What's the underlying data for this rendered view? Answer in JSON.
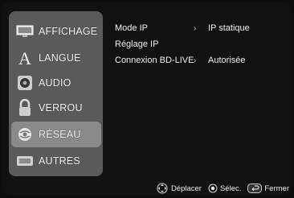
{
  "menu": {
    "items": [
      {
        "label": "AFFICHAGE",
        "icon": "display-icon"
      },
      {
        "label": "LANGUE",
        "icon": "language-icon"
      },
      {
        "label": "AUDIO",
        "icon": "audio-icon"
      },
      {
        "label": "VERROU",
        "icon": "lock-icon"
      },
      {
        "label": "RÉSEAU",
        "icon": "network-icon",
        "selected": true
      },
      {
        "label": "AUTRES",
        "icon": "others-icon"
      }
    ]
  },
  "options": [
    {
      "label": "Mode IP",
      "arrow": "›",
      "value": "IP statique"
    },
    {
      "label": "Réglage IP",
      "arrow": "",
      "value": ""
    },
    {
      "label": "Connexion BD-LIVE",
      "arrow": "›",
      "value": "Autorisée"
    }
  ],
  "footer": {
    "move_label": "Déplacer",
    "select_label": "Sélec.",
    "close_label": "Fermer"
  },
  "colors": {
    "panel": "#5a5a5a",
    "selected": "#8a8a8a",
    "background": "#111111"
  }
}
